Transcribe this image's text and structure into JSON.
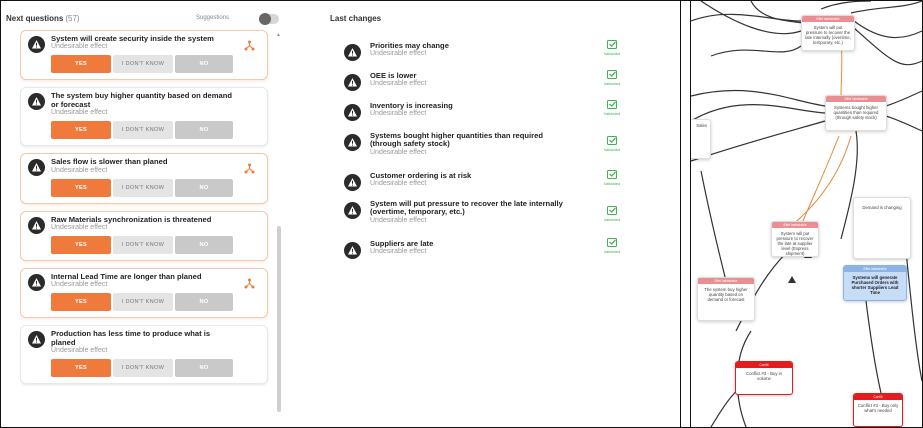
{
  "left": {
    "title": "Next questions",
    "count": "(57)",
    "suggestions_label": "Suggestions",
    "questions": [
      {
        "title": "System will create security inside the system",
        "subtitle": "Undesirable effect",
        "yes": "YES",
        "idk": "I DON'T KNOW",
        "no": "NO"
      },
      {
        "title": "The system buy higher quantity based on demand or forecast",
        "subtitle": "Undesirable effect",
        "yes": "YES",
        "idk": "I DON'T KNOW",
        "no": "NO"
      },
      {
        "title": "Sales flow is slower than planed",
        "subtitle": "Undesirable effect",
        "yes": "YES",
        "idk": "I DON'T KNOW",
        "no": "NO"
      },
      {
        "title": "Raw Materials synchronization is threatened",
        "subtitle": "Undesirable effect",
        "yes": "YES",
        "idk": "I DON'T KNOW",
        "no": "NO"
      },
      {
        "title": "Internal Lead Time are longer than planed",
        "subtitle": "Undesirable effect",
        "yes": "YES",
        "idk": "I DON'T KNOW",
        "no": "NO"
      },
      {
        "title": "Production has less time to produce what is planed",
        "subtitle": "Undesirable effect",
        "yes": "YES",
        "idk": "I DON'T KNOW",
        "no": "NO"
      }
    ]
  },
  "middle": {
    "title": "Last changes",
    "changes": [
      {
        "title": "Priorities may change",
        "subtitle": "Undesirable effect",
        "status": "Validated"
      },
      {
        "title": "OEE is lower",
        "subtitle": "Undesirable effect",
        "status": "Validated"
      },
      {
        "title": "Inventory is increasing",
        "subtitle": "Undesirable effect",
        "status": "Validated"
      },
      {
        "title": "Systems bought higher quantities than required (through safety stock)",
        "subtitle": "Undesirable effect",
        "status": "Validated"
      },
      {
        "title": "Customer ordering is at risk",
        "subtitle": "Undesirable effect",
        "status": "Validated"
      },
      {
        "title": "System will put pressure to recover the late internally (overtime, temporary, etc.)",
        "subtitle": "Undesirable effect",
        "status": "Validated"
      },
      {
        "title": "Suppliers are late",
        "subtitle": "Undesirable effect",
        "status": "Validated"
      }
    ]
  },
  "graph": {
    "nodes": [
      {
        "header": "Effet Indésirable",
        "body": "System will put pressure to recover the late internally (overtime, temporary, etc.)"
      },
      {
        "header": "Effet Indésirable",
        "body": "Systems bought higher quantities than required (through safety stock)"
      },
      {
        "header": "",
        "body": "Sales"
      },
      {
        "header": "",
        "body": "Demand is changing"
      },
      {
        "header": "Effet Indésirable",
        "body": "System will put pressure to recover the late at supplier level (Express shipment)"
      },
      {
        "header": "Effet Indésirable",
        "body": "The system buy higher quantity based on demand or forecast"
      },
      {
        "header": "Effet Indésirable",
        "body": "Systems will generate Purchased Orders with shorter Suppliers Lead Time"
      },
      {
        "header": "Conflit",
        "body": "Conflict #3 - Buy in volume"
      },
      {
        "header": "Conflit",
        "body": "Conflict #3 - Buy only what's needed"
      }
    ]
  },
  "colors": {
    "accent": "#f07a3c",
    "validated": "#3fb54f",
    "undesirable_header": "#e98f93",
    "conflict": "#e11d1d",
    "blue_node": "#c6dcf7"
  }
}
